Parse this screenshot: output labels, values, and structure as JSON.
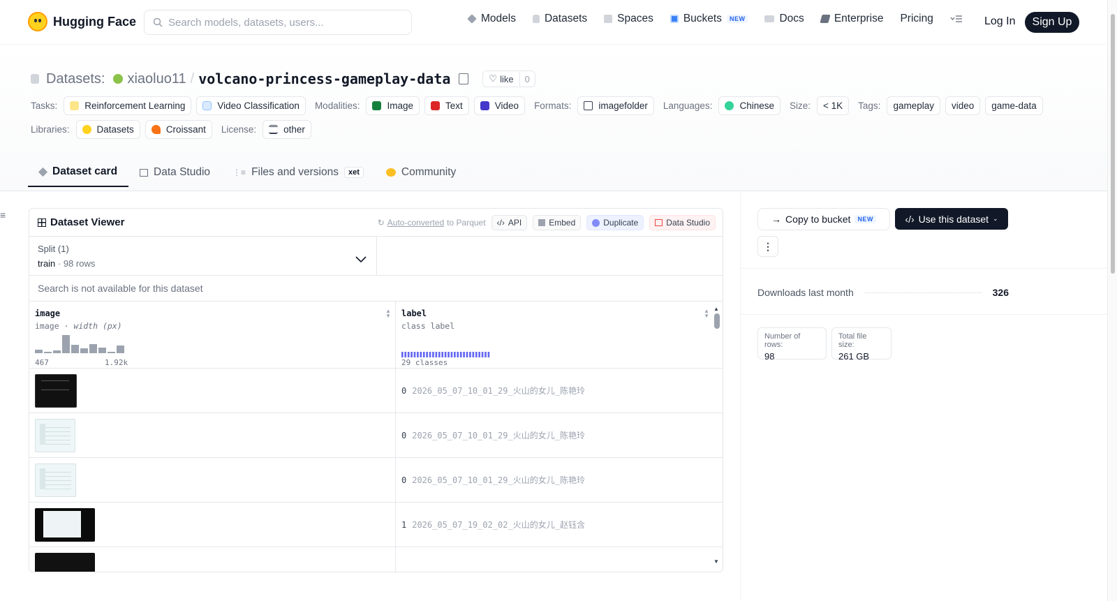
{
  "nav": {
    "brand": "Hugging Face",
    "search_placeholder": "Search models, datasets, users...",
    "items": [
      {
        "label": "Models"
      },
      {
        "label": "Datasets"
      },
      {
        "label": "Spaces"
      },
      {
        "label": "Buckets",
        "badge": "NEW"
      },
      {
        "label": "Docs"
      },
      {
        "label": "Enterprise"
      },
      {
        "label": "Pricing"
      }
    ],
    "login": "Log In",
    "signup": "Sign Up"
  },
  "repo": {
    "type_label": "Datasets:",
    "owner": "xiaoluo11",
    "separator": "/",
    "name": "volcano-princess-gameplay-data",
    "like_label": "like",
    "like_count": "0"
  },
  "meta": {
    "tasks_label": "Tasks:",
    "tasks": [
      "Reinforcement Learning",
      "Video Classification"
    ],
    "modalities_label": "Modalities:",
    "modalities": [
      "Image",
      "Text",
      "Video"
    ],
    "formats_label": "Formats:",
    "formats": [
      "imagefolder"
    ],
    "languages_label": "Languages:",
    "languages": [
      "Chinese"
    ],
    "size_label": "Size:",
    "size": "< 1K",
    "tags_label": "Tags:",
    "tags": [
      "gameplay",
      "video",
      "game-data"
    ],
    "libraries_label": "Libraries:",
    "libraries": [
      "Datasets",
      "Croissant"
    ],
    "license_label": "License:",
    "license": "other"
  },
  "tabs": [
    {
      "label": "Dataset card",
      "active": true
    },
    {
      "label": "Data Studio"
    },
    {
      "label": "Files and versions",
      "badge": "xet"
    },
    {
      "label": "Community"
    }
  ],
  "viewer": {
    "title": "Dataset Viewer",
    "auto_converted_link": "Auto-converted",
    "auto_converted_rest": "to Parquet",
    "api": "API",
    "embed": "Embed",
    "duplicate": "Duplicate",
    "data_studio": "Data Studio",
    "split_title": "Split (1)",
    "split_name": "train",
    "split_rows": "98 rows",
    "search_na": "Search is not available for this dataset",
    "columns": [
      {
        "name": "image",
        "type": "image",
        "type_extra": "width (px)",
        "min": "467",
        "max": "1.92k"
      },
      {
        "name": "label",
        "type": "class label",
        "classes": "29 classes"
      }
    ],
    "rows": [
      {
        "class": "0",
        "label": "2026_05_07_10_01_29_火山的女儿_陈艳玲"
      },
      {
        "class": "0",
        "label": "2026_05_07_10_01_29_火山的女儿_陈艳玲"
      },
      {
        "class": "0",
        "label": "2026_05_07_10_01_29_火山的女儿_陈艳玲"
      },
      {
        "class": "1",
        "label": "2026_05_07_19_02_02_火山的女儿_赵钰含"
      }
    ]
  },
  "sidebar": {
    "copy_to_bucket": "Copy to bucket",
    "copy_badge": "NEW",
    "use_dataset": "Use this dataset",
    "downloads_label": "Downloads last month",
    "downloads_value": "326",
    "rows_label": "Number of rows:",
    "rows_value": "98",
    "size_label": "Total file size:",
    "size_value": "261 GB"
  },
  "colors": {
    "accent": "#111827",
    "brand": "#ffd21e",
    "class_bar": "#6366f1"
  }
}
